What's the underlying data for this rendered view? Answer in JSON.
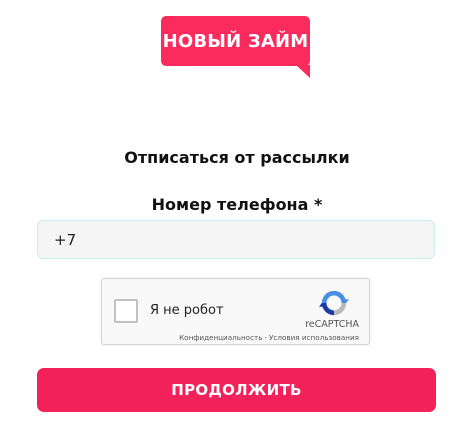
{
  "logo": {
    "text": "НОВЫЙ ЗАЙМ",
    "color": "#fb2b5e"
  },
  "heading": "Отписаться от рассылки",
  "phone": {
    "label": "Номер телефона *",
    "value": "+7"
  },
  "captcha": {
    "label": "Я не робот",
    "brand": "reCAPTCHA",
    "privacy_link": "Конфиденциальность",
    "separator": "-",
    "terms_link": "Условия использования",
    "logo_icon": "recaptcha-icon"
  },
  "submit": {
    "label": "ПРОДОЛЖИТЬ",
    "color": "#f2215a"
  }
}
